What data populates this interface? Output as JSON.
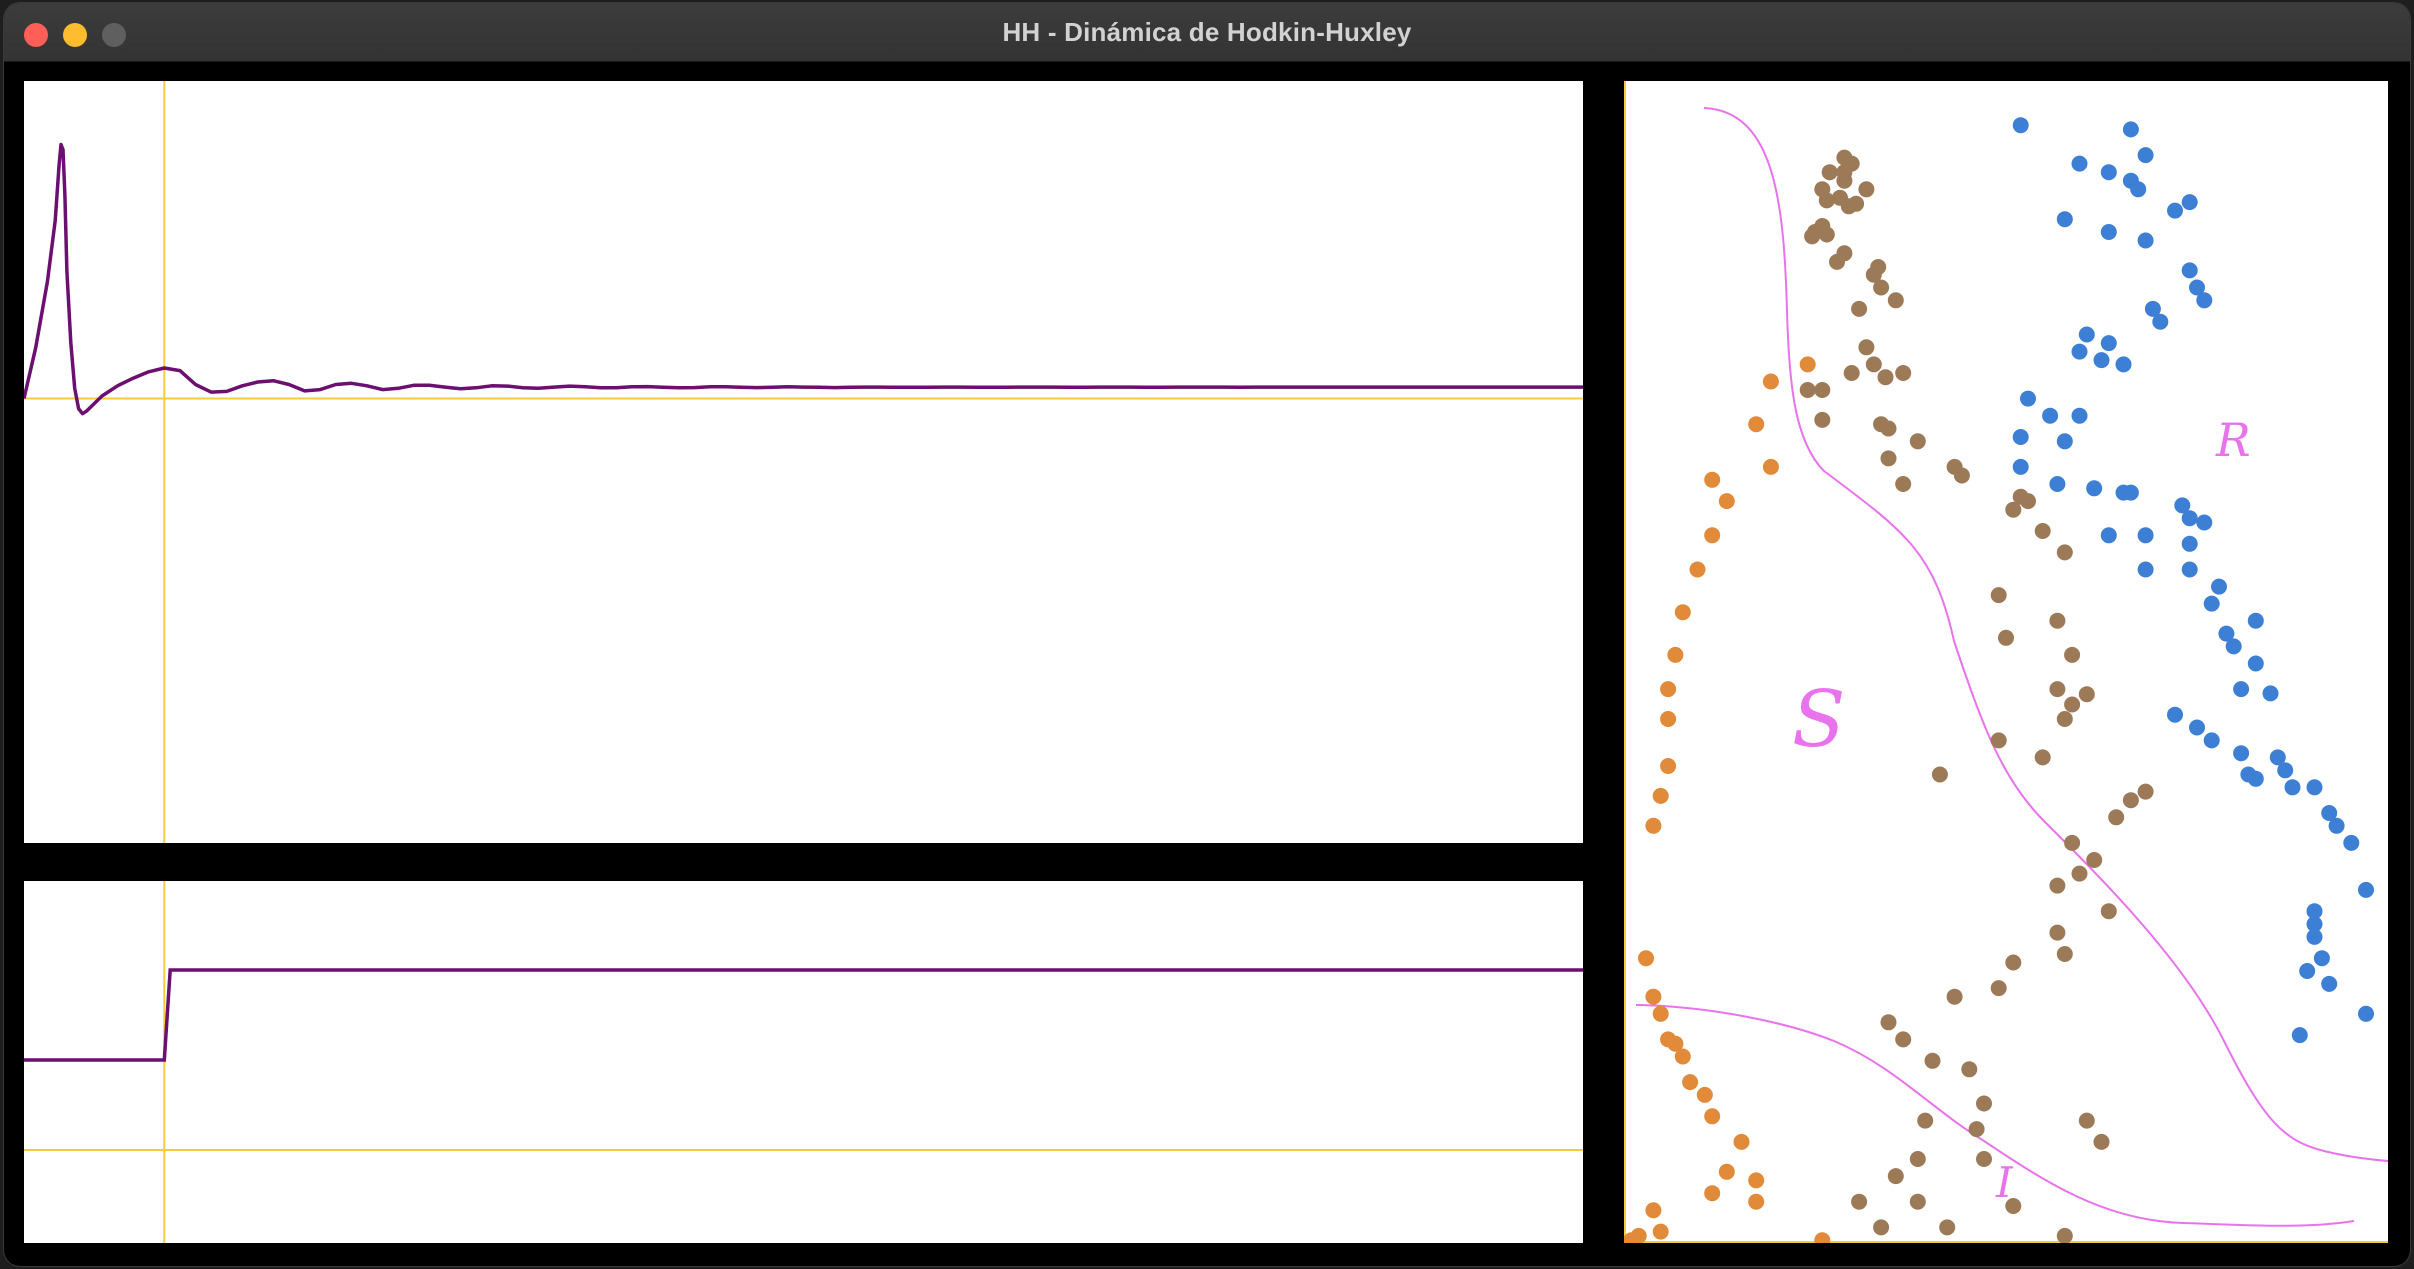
{
  "window": {
    "title": "HH - Dinámica de Hodkin-Huxley",
    "controls": [
      "close",
      "minimize",
      "zoom"
    ]
  },
  "colors": {
    "trace": "#6b0f70",
    "axis": "#f3cd3b",
    "annotation": "#e873ec",
    "s_dot": "#9c7a58",
    "r_dot": "#3e7fd6",
    "i_dot": "#e08a3a"
  },
  "chart_data": [
    {
      "type": "line",
      "description_key": "membrane_voltage",
      "series": [
        {
          "x": [
            0,
            3,
            6,
            8,
            9,
            9.5,
            10,
            10.5,
            11,
            12,
            13,
            14,
            15,
            16,
            18,
            20,
            24,
            28,
            32,
            36,
            40,
            44,
            48,
            52,
            56,
            60,
            64,
            68,
            72,
            76,
            80,
            84,
            88,
            92,
            96,
            100,
            104,
            108,
            112,
            116,
            120,
            124,
            128,
            132,
            136,
            140,
            144,
            148,
            152,
            156,
            160,
            164,
            168,
            172,
            176,
            180,
            184,
            188,
            192,
            196,
            200,
            204,
            208,
            212,
            216,
            220,
            224,
            228,
            232,
            236,
            240,
            244,
            248,
            252,
            256,
            260,
            264,
            268,
            272,
            276,
            280,
            284,
            288,
            292,
            296,
            300,
            304,
            308,
            312,
            316,
            320,
            324,
            328,
            332,
            336,
            340,
            344,
            348,
            352,
            356,
            360,
            364,
            368,
            372,
            376,
            380,
            384,
            388,
            392,
            396,
            400
          ],
          "y": [
            0,
            20,
            46,
            70,
            92,
            100,
            98,
            80,
            50,
            22,
            4,
            -4,
            -6,
            -5,
            -2,
            1,
            5,
            8,
            10.5,
            12,
            11,
            5.5,
            2.5,
            2.8,
            5,
            6.5,
            7,
            5.5,
            3,
            3.5,
            5.5,
            6,
            5,
            3.5,
            4,
            5.2,
            5.2,
            4.5,
            3.8,
            4.2,
            5,
            4.9,
            4.2,
            4,
            4.5,
            4.9,
            4.6,
            4.2,
            4.2,
            4.6,
            4.7,
            4.4,
            4.2,
            4.3,
            4.6,
            4.6,
            4.4,
            4.3,
            4.4,
            4.6,
            4.5,
            4.4,
            4.3,
            4.4,
            4.5,
            4.5,
            4.4,
            4.4,
            4.4,
            4.5,
            4.5,
            4.4,
            4.4,
            4.4,
            4.5,
            4.5,
            4.5,
            4.4,
            4.4,
            4.5,
            4.5,
            4.5,
            4.4,
            4.4,
            4.5,
            4.5,
            4.5,
            4.5,
            4.4,
            4.5,
            4.5,
            4.5,
            4.5,
            4.5,
            4.5,
            4.5,
            4.5,
            4.5,
            4.5,
            4.5,
            4.5,
            4.5,
            4.5,
            4.5,
            4.5,
            4.5,
            4.5,
            4.5,
            4.5,
            4.5,
            4.5
          ]
        }
      ]
    },
    {
      "type": "line",
      "description_key": "stimulus_current",
      "series": [
        {
          "x": [
            0,
            36,
            37.5,
            400
          ],
          "y": [
            1,
            1,
            2,
            2
          ]
        }
      ]
    },
    {
      "type": "scatter",
      "description_key": "phase_plane",
      "annotations": [
        "R",
        "S",
        "I"
      ],
      "series": [
        {
          "name_key": "S",
          "points": [
            [
              155,
              85
            ],
            [
              150,
              78
            ],
            [
              140,
              95
            ],
            [
              150,
              95
            ],
            [
              150,
              105
            ],
            [
              165,
              115
            ],
            [
              135,
              115
            ],
            [
              147,
              125
            ],
            [
              138,
              128
            ],
            [
              158,
              132
            ],
            [
              153,
              135
            ],
            [
              135,
              158
            ],
            [
              130,
              165
            ],
            [
              138,
              168
            ],
            [
              128,
              170
            ],
            [
              150,
              190
            ],
            [
              145,
              200
            ],
            [
              173,
              206
            ],
            [
              170,
              215
            ],
            [
              175,
              230
            ],
            [
              185,
              245
            ],
            [
              160,
              255
            ],
            [
              165,
              300
            ],
            [
              170,
              320
            ],
            [
              155,
              330
            ],
            [
              190,
              330
            ],
            [
              178,
              335
            ],
            [
              125,
              350
            ],
            [
              135,
              350
            ],
            [
              135,
              385
            ],
            [
              175,
              390
            ],
            [
              180,
              395
            ],
            [
              200,
              410
            ],
            [
              180,
              430
            ],
            [
              225,
              440
            ],
            [
              230,
              450
            ],
            [
              190,
              460
            ],
            [
              270,
              475
            ],
            [
              275,
              480
            ],
            [
              265,
              490
            ],
            [
              285,
              515
            ],
            [
              300,
              540
            ],
            [
              255,
              590
            ],
            [
              295,
              620
            ],
            [
              260,
              640
            ],
            [
              305,
              660
            ],
            [
              295,
              700
            ],
            [
              315,
              706
            ],
            [
              305,
              718
            ],
            [
              300,
              735
            ],
            [
              255,
              760
            ],
            [
              285,
              780
            ],
            [
              215,
              800
            ],
            [
              355,
              820
            ],
            [
              345,
              830
            ],
            [
              335,
              850
            ],
            [
              305,
              880
            ],
            [
              320,
              900
            ],
            [
              310,
              916
            ],
            [
              295,
              930
            ],
            [
              330,
              960
            ],
            [
              295,
              985
            ],
            [
              300,
              1010
            ],
            [
              265,
              1020
            ],
            [
              255,
              1050
            ],
            [
              225,
              1060
            ],
            [
              180,
              1090
            ],
            [
              190,
              1110
            ],
            [
              210,
              1135
            ],
            [
              235,
              1145
            ],
            [
              245,
              1185
            ],
            [
              205,
              1205
            ],
            [
              240,
              1215
            ],
            [
              245,
              1250
            ],
            [
              315,
              1205
            ],
            [
              325,
              1230
            ],
            [
              200,
              1250
            ],
            [
              185,
              1270
            ],
            [
              160,
              1300
            ],
            [
              200,
              1300
            ],
            [
              175,
              1330
            ],
            [
              220,
              1330
            ],
            [
              265,
              1305
            ],
            [
              300,
              1340
            ],
            [
              350,
              1410
            ],
            [
              355,
              1400
            ],
            [
              335,
              1430
            ],
            [
              360,
              1440
            ]
          ]
        },
        {
          "name_key": "R",
          "points": [
            [
              270,
              40
            ],
            [
              345,
              45
            ],
            [
              355,
              75
            ],
            [
              310,
              85
            ],
            [
              330,
              95
            ],
            [
              345,
              105
            ],
            [
              350,
              115
            ],
            [
              385,
              130
            ],
            [
              375,
              140
            ],
            [
              300,
              150
            ],
            [
              330,
              165
            ],
            [
              355,
              175
            ],
            [
              385,
              210
            ],
            [
              390,
              230
            ],
            [
              395,
              245
            ],
            [
              360,
              255
            ],
            [
              365,
              270
            ],
            [
              315,
              285
            ],
            [
              330,
              295
            ],
            [
              310,
              305
            ],
            [
              325,
              315
            ],
            [
              340,
              320
            ],
            [
              275,
              360
            ],
            [
              290,
              380
            ],
            [
              310,
              380
            ],
            [
              270,
              405
            ],
            [
              300,
              410
            ],
            [
              270,
              440
            ],
            [
              295,
              460
            ],
            [
              320,
              465
            ],
            [
              345,
              470
            ],
            [
              340,
              470
            ],
            [
              380,
              485
            ],
            [
              385,
              500
            ],
            [
              395,
              505
            ],
            [
              330,
              520
            ],
            [
              355,
              520
            ],
            [
              385,
              530
            ],
            [
              355,
              560
            ],
            [
              385,
              560
            ],
            [
              405,
              580
            ],
            [
              400,
              600
            ],
            [
              430,
              620
            ],
            [
              410,
              635
            ],
            [
              415,
              650
            ],
            [
              430,
              670
            ],
            [
              420,
              700
            ],
            [
              440,
              705
            ],
            [
              375,
              730
            ],
            [
              390,
              745
            ],
            [
              400,
              760
            ],
            [
              420,
              775
            ],
            [
              445,
              780
            ],
            [
              425,
              800
            ],
            [
              430,
              805
            ],
            [
              450,
              795
            ],
            [
              455,
              815
            ],
            [
              470,
              815
            ],
            [
              480,
              845
            ],
            [
              485,
              860
            ],
            [
              495,
              880
            ],
            [
              505,
              935
            ],
            [
              470,
              960
            ],
            [
              470,
              975
            ],
            [
              470,
              990
            ],
            [
              475,
              1015
            ],
            [
              465,
              1030
            ],
            [
              480,
              1045
            ],
            [
              505,
              1080
            ],
            [
              460,
              1105
            ]
          ]
        },
        {
          "name_key": "I",
          "points": [
            [
              125,
              320
            ],
            [
              100,
              340
            ],
            [
              90,
              390
            ],
            [
              100,
              440
            ],
            [
              60,
              455
            ],
            [
              70,
              480
            ],
            [
              60,
              520
            ],
            [
              50,
              560
            ],
            [
              40,
              610
            ],
            [
              35,
              660
            ],
            [
              30,
              700
            ],
            [
              30,
              735
            ],
            [
              30,
              790
            ],
            [
              25,
              825
            ],
            [
              20,
              860
            ],
            [
              15,
              1015
            ],
            [
              20,
              1060
            ],
            [
              25,
              1080
            ],
            [
              30,
              1110
            ],
            [
              35,
              1115
            ],
            [
              40,
              1130
            ],
            [
              45,
              1160
            ],
            [
              55,
              1175
            ],
            [
              60,
              1200
            ],
            [
              80,
              1230
            ],
            [
              70,
              1265
            ],
            [
              90,
              1275
            ],
            [
              60,
              1290
            ],
            [
              90,
              1300
            ],
            [
              20,
              1310
            ],
            [
              25,
              1335
            ],
            [
              10,
              1340
            ],
            [
              5,
              1345
            ],
            [
              0,
              1350
            ],
            [
              135,
              1345
            ]
          ]
        }
      ]
    }
  ]
}
